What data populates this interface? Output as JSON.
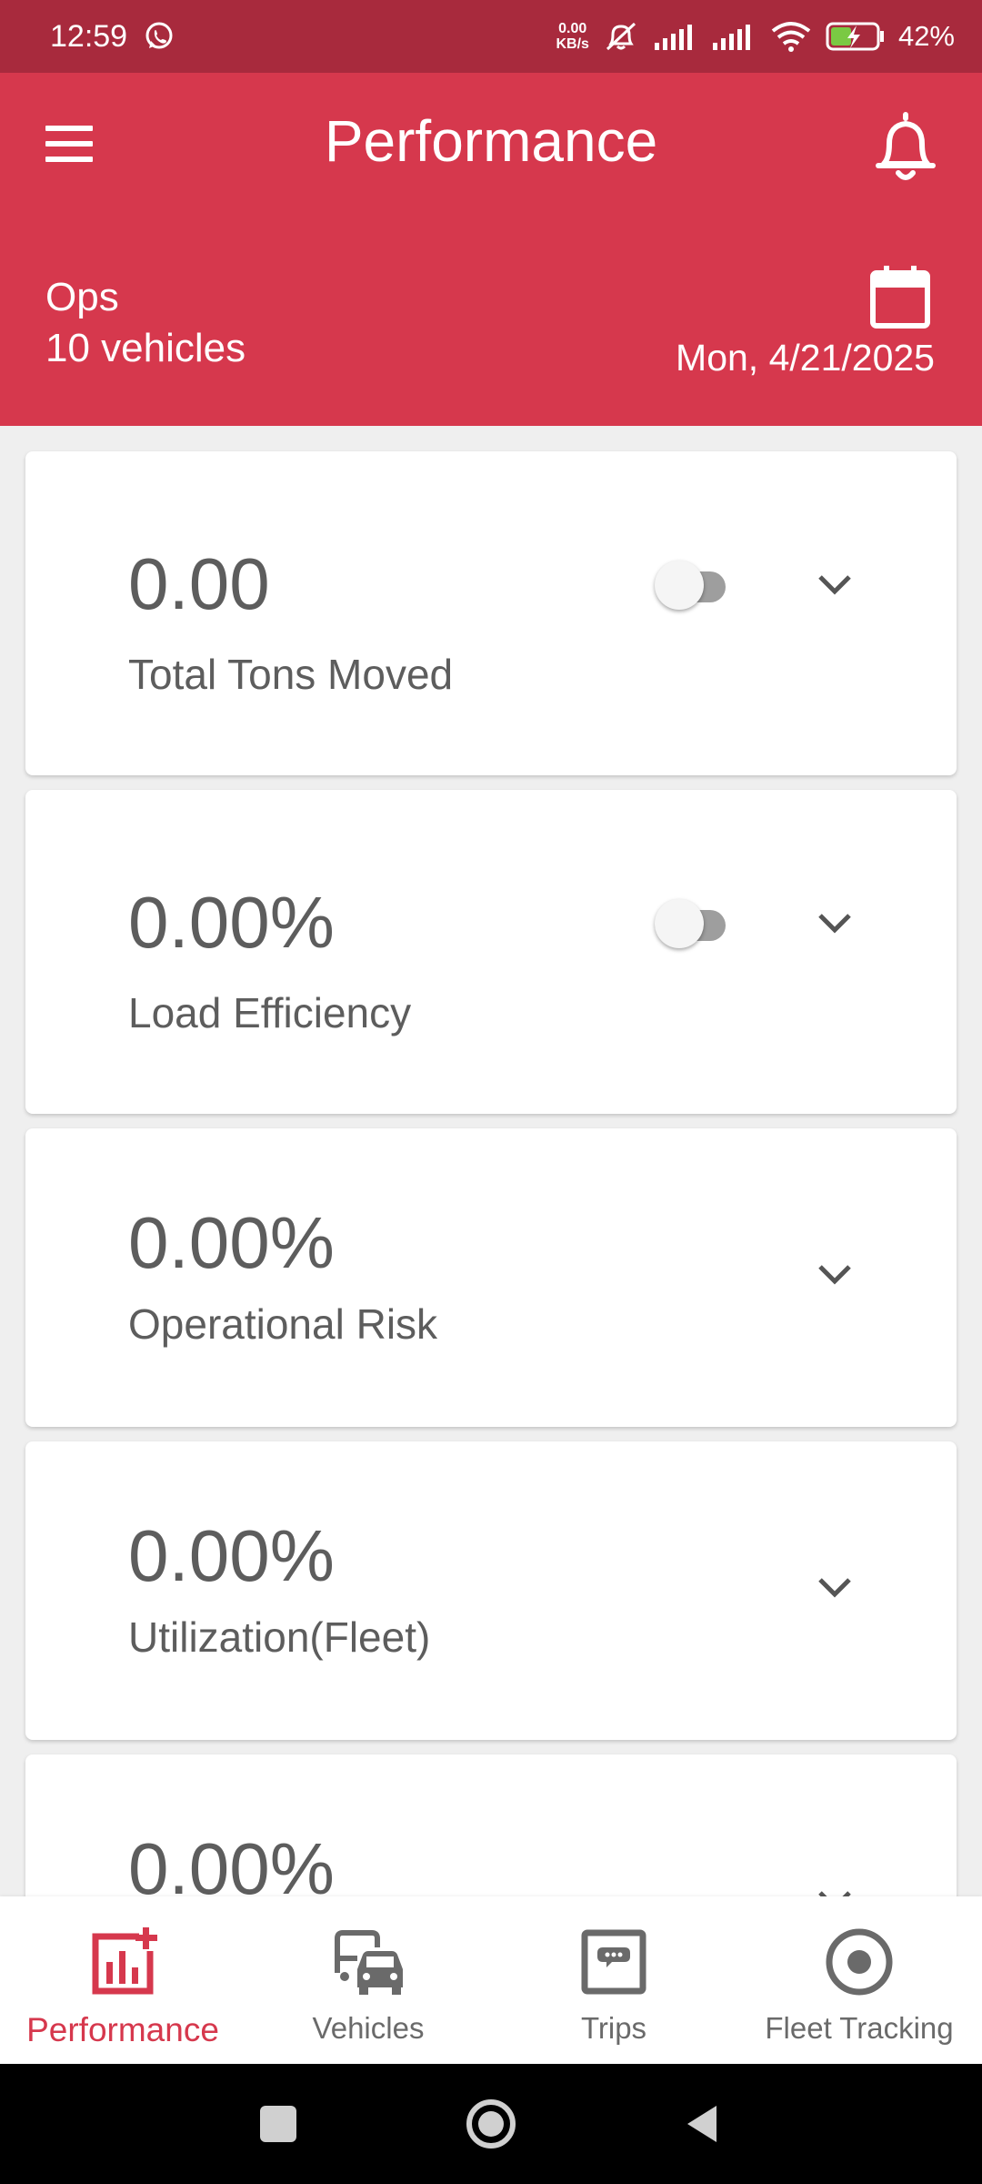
{
  "status_bar": {
    "time": "12:59",
    "speed_value": "0.00",
    "speed_unit": "KB/s",
    "battery": "42%"
  },
  "header": {
    "title": "Performance",
    "group_name": "Ops",
    "vehicle_count": "10 vehicles",
    "date": "Mon, 4/21/2025",
    "accent_color": "#d6384d"
  },
  "metrics": [
    {
      "value": "0.00",
      "label": "Total  Tons Moved",
      "toggle_visible": true,
      "toggle_on": false
    },
    {
      "value": "0.00%",
      "label": "Load Efficiency",
      "toggle_visible": true,
      "toggle_on": false
    },
    {
      "value": "0.00%",
      "label": "Operational Risk",
      "toggle_visible": false
    },
    {
      "value": "0.00%",
      "label": "Utilization(Fleet)",
      "toggle_visible": false
    },
    {
      "value": "0.00%",
      "label": "",
      "toggle_visible": false
    }
  ],
  "bottom_nav": {
    "items": [
      {
        "label": "Performance",
        "icon": "performance-chart-icon",
        "active": true
      },
      {
        "label": "Vehicles",
        "icon": "vehicles-icon",
        "active": false
      },
      {
        "label": "Trips",
        "icon": "trips-icon",
        "active": false
      },
      {
        "label": "Fleet Tracking",
        "icon": "fleet-tracking-icon",
        "active": false
      }
    ]
  }
}
